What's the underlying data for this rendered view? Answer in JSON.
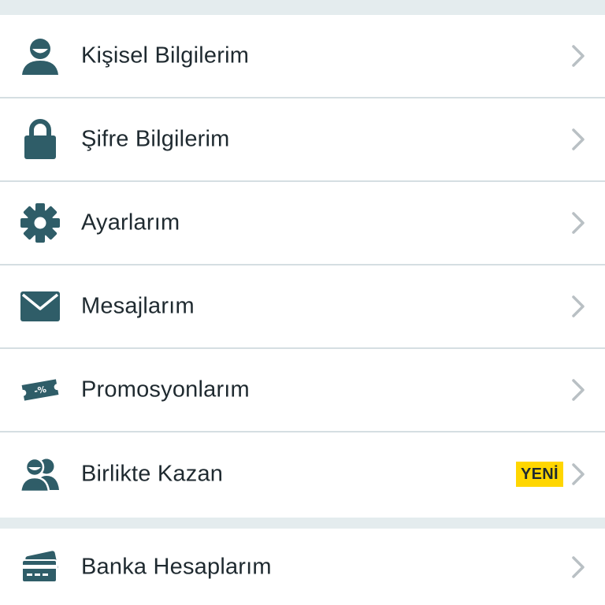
{
  "colors": {
    "icon": "#2f5d68",
    "chevron": "#b9c0c4",
    "divider": "#d5dee2",
    "background": "#e4ecee",
    "badge": "#ffd600"
  },
  "menu": {
    "items": [
      {
        "label": "Kişisel Bilgilerim",
        "icon": "user-icon"
      },
      {
        "label": "Şifre Bilgilerim",
        "icon": "lock-icon"
      },
      {
        "label": "Ayarlarım",
        "icon": "gear-icon"
      },
      {
        "label": "Mesajlarım",
        "icon": "envelope-icon"
      },
      {
        "label": "Promosyonlarım",
        "icon": "promo-ticket-icon"
      },
      {
        "label": "Birlikte Kazan",
        "icon": "users-icon",
        "badge": "YENİ"
      }
    ]
  },
  "menu2": {
    "items": [
      {
        "label": "Banka Hesaplarım",
        "icon": "credit-card-icon"
      }
    ]
  },
  "promo_icon_text": "-%"
}
